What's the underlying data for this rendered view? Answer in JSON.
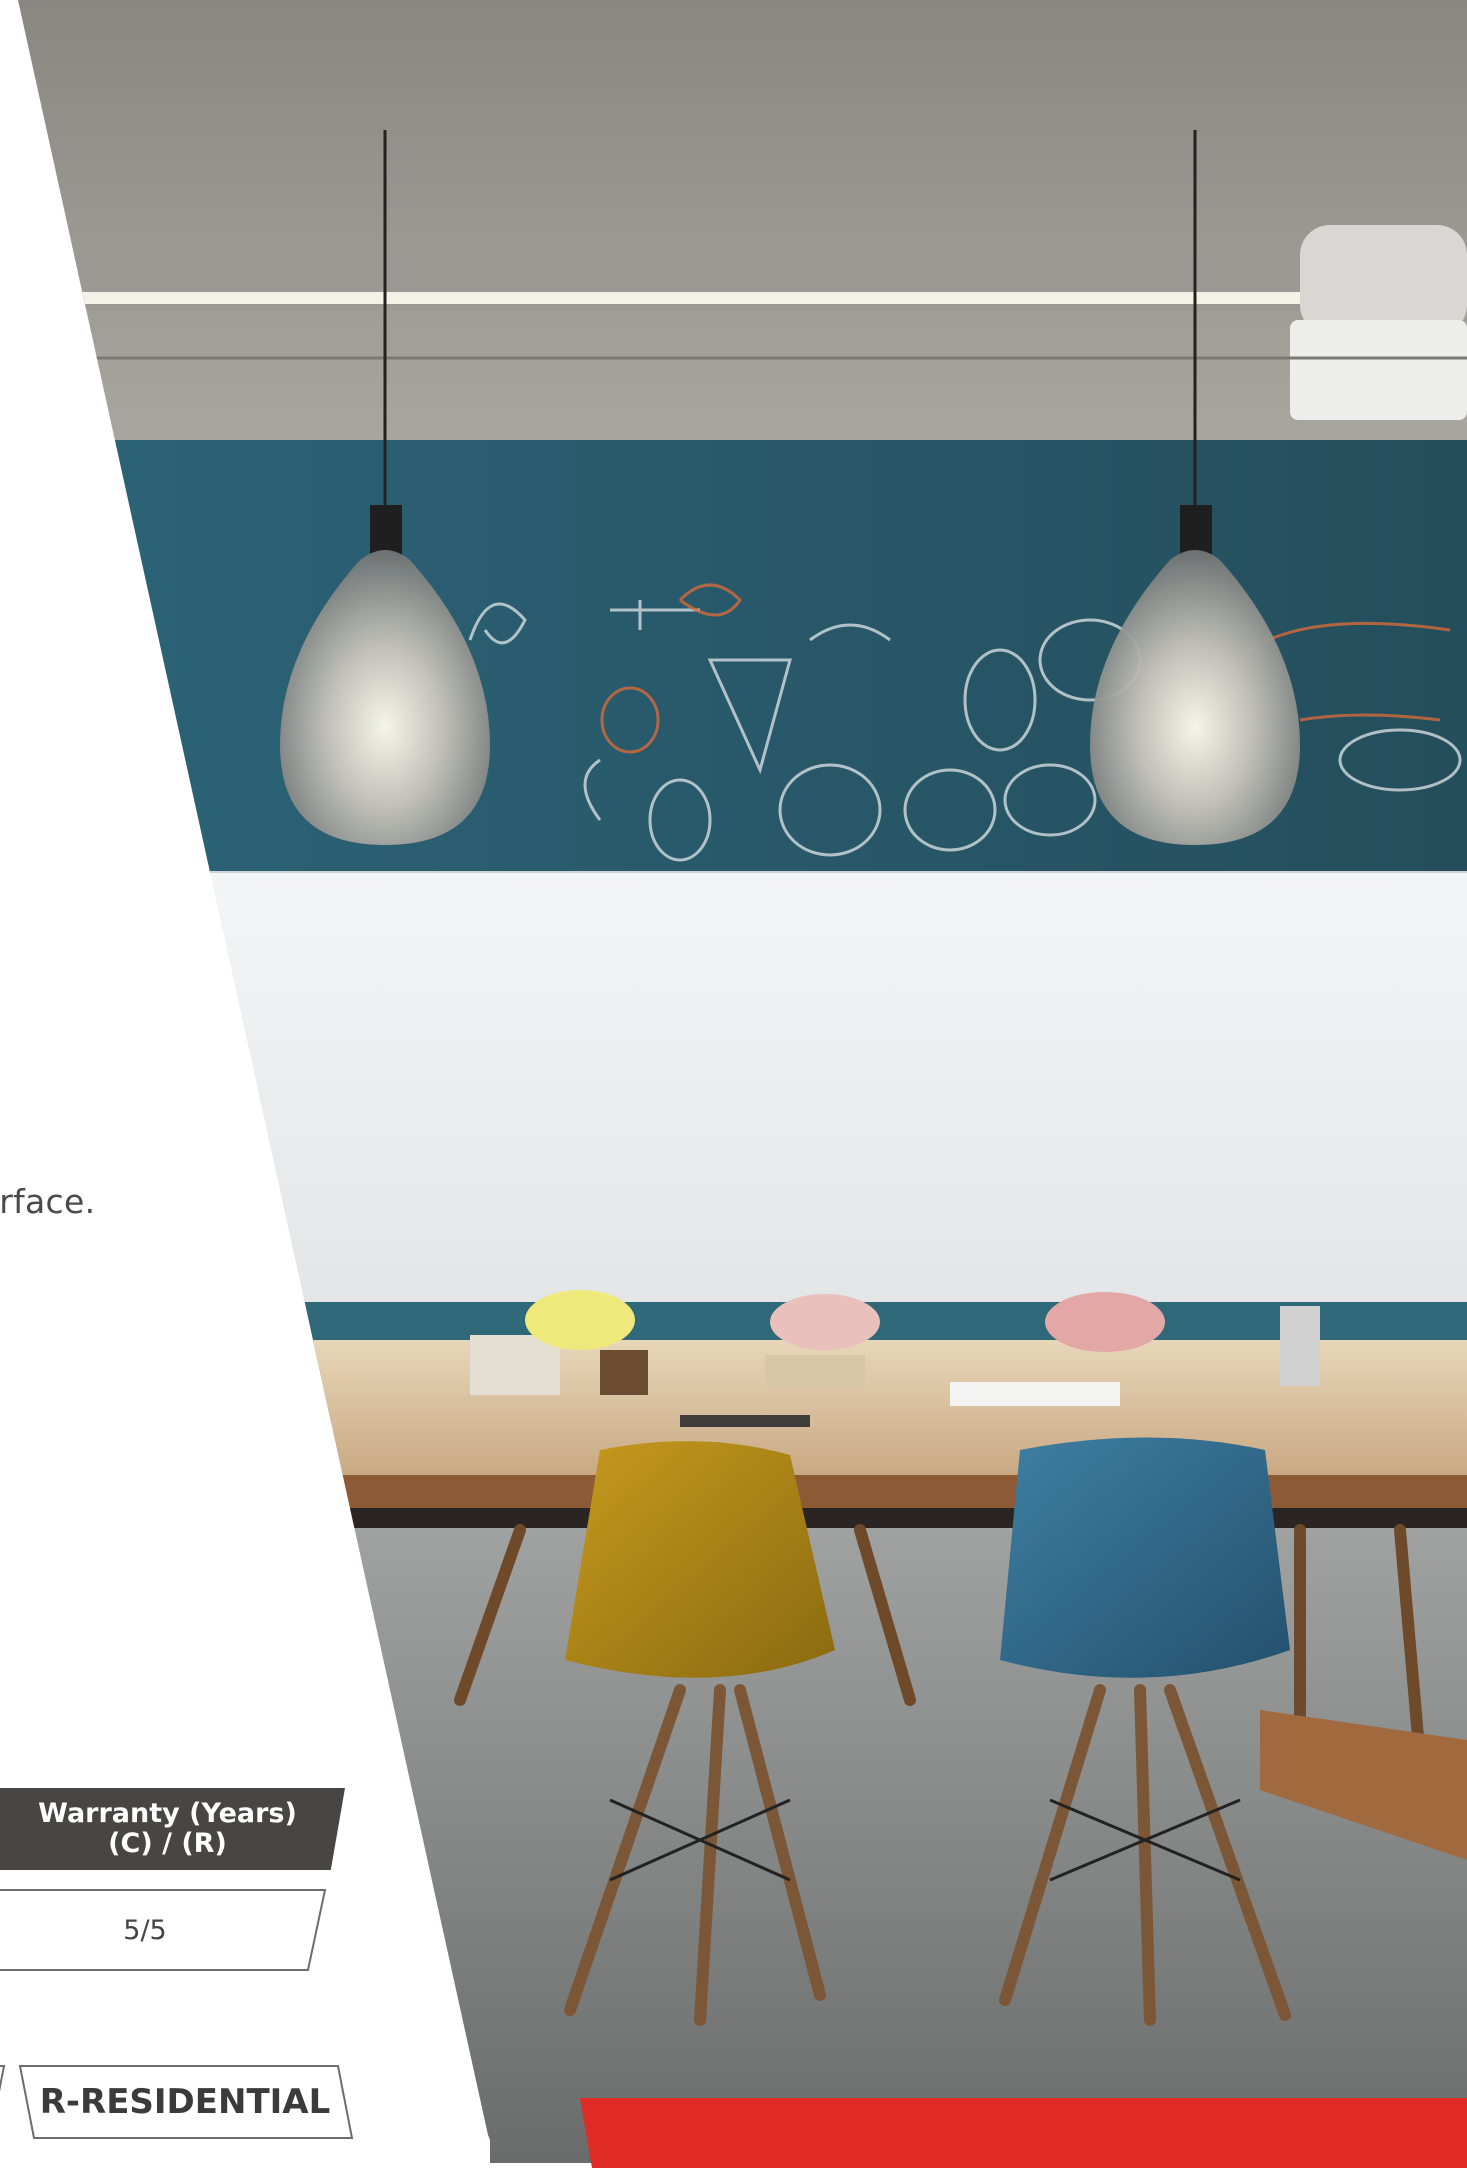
{
  "body_text": "urface.",
  "specs_table": {
    "header": "Warranty (Years)",
    "subheader": "(C) / (R)",
    "value": "5/5"
  },
  "legend": {
    "residential_label": "R-RESIDENTIAL"
  },
  "colors": {
    "table_header_bg": "#484544",
    "accent_red": "#e02a26",
    "chalkboard_teal": "#2e5a6a"
  },
  "photo": {
    "subject": "interior-photo"
  }
}
